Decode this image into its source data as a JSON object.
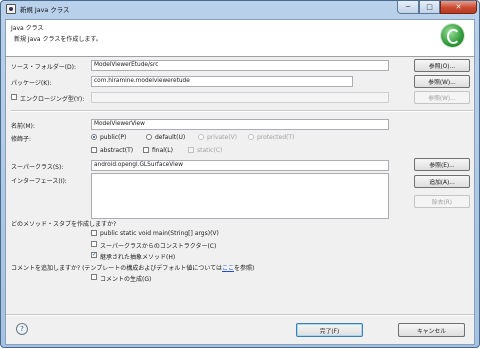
{
  "window": {
    "title": "新規 Java クラス",
    "min_label": "─",
    "max_label": "□",
    "close_label": "✕"
  },
  "banner": {
    "title": "Java クラス",
    "description": "新規 Java クラスを作成します。",
    "logo_icon": "eclipse-new-class-icon"
  },
  "source_folder": {
    "label": "ソース・フォルダー(D):",
    "value": "ModelViewerEtude/src",
    "browse_label": "参照(O)..."
  },
  "package": {
    "label": "パッケージ(K):",
    "value": "com.hiramine.modelvieweretude",
    "browse_label": "参照(W)..."
  },
  "enclosing": {
    "label": "エンクロージング型(Y):",
    "checked": false,
    "value": "",
    "browse_label": "参照(W)..."
  },
  "name": {
    "label": "名前(M):",
    "value": "ModelViewerView"
  },
  "modifiers": {
    "label": "修飾子:",
    "radios": [
      {
        "label": "public(P)",
        "selected": true,
        "enabled": true
      },
      {
        "label": "default(U)",
        "selected": false,
        "enabled": true
      },
      {
        "label": "private(V)",
        "selected": false,
        "enabled": false
      },
      {
        "label": "protected(T)",
        "selected": false,
        "enabled": false
      }
    ],
    "checks": [
      {
        "label": "abstract(T)",
        "checked": false,
        "enabled": true
      },
      {
        "label": "final(L)",
        "checked": false,
        "enabled": true
      },
      {
        "label": "static(C)",
        "checked": false,
        "enabled": false
      }
    ]
  },
  "superclass": {
    "label": "スーパークラス(S):",
    "value": "android.opengl.GLSurfaceView",
    "browse_label": "参照(E)..."
  },
  "interfaces": {
    "label": "インターフェース(I):",
    "add_label": "追加(A)...",
    "remove_label": "除去(R)"
  },
  "stubs": {
    "question": "どのメソッド・スタブを作成しますか?",
    "options": [
      {
        "label": "public static void main(String[] args)(V)",
        "checked": false
      },
      {
        "label": "スーパークラスからのコンストラクター(C)",
        "checked": false
      },
      {
        "label": "継承された抽象メソッド(H)",
        "checked": true
      }
    ]
  },
  "comments": {
    "question_prefix": "コメントを追加しますか? (テンプレートの構成およびデフォルト値については",
    "link": "ここ",
    "question_suffix": "を参照)",
    "option": {
      "label": "コメントの生成(G)",
      "checked": false
    }
  },
  "footer": {
    "help_icon": "help-icon",
    "finish_label": "完了(F)",
    "cancel_label": "キャンセル"
  }
}
